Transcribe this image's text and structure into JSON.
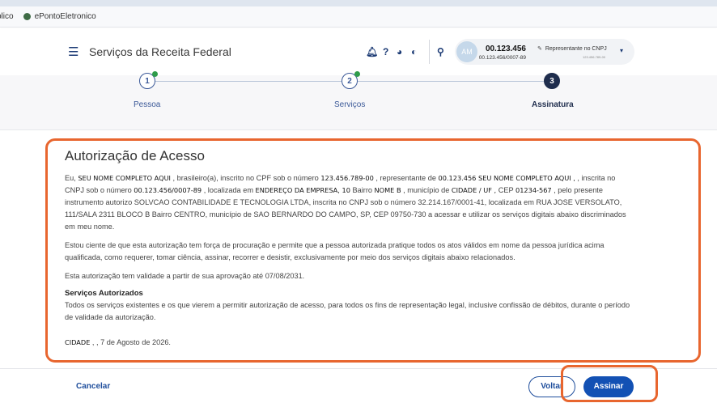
{
  "browser": {
    "bookmarks": [
      {
        "label": "blico"
      },
      {
        "label": "ePontoEletronico"
      }
    ]
  },
  "header": {
    "title": "Serviços da Receita Federal",
    "icons": [
      "bell-icon",
      "help-icon",
      "contrast-icon",
      "theme-icon",
      "search-icon"
    ],
    "user": {
      "avatar_initials": "AM",
      "cnpj": "00.123.456",
      "cnpj_full": "00.123.456/0007-89",
      "role": "Representante no CNPJ",
      "role_sub": "123.456.789-00"
    }
  },
  "stepper": {
    "steps": [
      {
        "number": "1",
        "label": "Pessoa",
        "done": true
      },
      {
        "number": "2",
        "label": "Serviços",
        "done": true
      },
      {
        "number": "3",
        "label": "Assinatura",
        "active": true
      }
    ]
  },
  "authorization": {
    "title": "Autorização de Acesso",
    "p1": {
      "t1": "Eu, ",
      "name": "SEU NOME COMPLETO AQUI",
      "t2": "     , brasileiro(a), inscrito no CPF sob o número ",
      "cpf": "123.456.789-00",
      "t3": " , representante de ",
      "cnpj": "00.123.456",
      "company": " SEU NOME COMPLETO AQUI ,",
      "t4": "         , inscrita no CNPJ sob o número ",
      "cnpj_full": "00.123.456/0007-89",
      "t5": "     , localizada em ",
      "address": "ENDEREÇO DA EMPRESA, 10",
      "t6": " Bairro ",
      "bairro": "NOME B",
      "t7": " , município de ",
      "city": "CIDADE / UF ,",
      "t8": " CEP ",
      "cep": "01234-567",
      "t9": " , pelo presente instrumento autorizo SOLVCAO CONTABILIDADE E TECNOLOGIA LTDA, inscrita no CNPJ sob o número 32.214.167/0001-41, localizada em RUA JOSE VERSOLATO, 111/SALA 2311 BLOCO B Bairro CENTRO, município de SAO BERNARDO DO CAMPO, SP, CEP 09750-730 a acessar e utilizar os serviços digitais abaixo discriminados em meu nome."
    },
    "p2": "Estou ciente de que esta autorização tem força de procuração e permite que a pessoa autorizada pratique todos os atos válidos em nome da pessoa jurídica acima qualificada, como requerer, tomar ciência, assinar, recorrer e desistir, exclusivamente por meio dos serviços digitais abaixo relacionados.",
    "p3": "Esta autorização tem validade a partir de sua aprovação até 07/08/2031.",
    "services_heading": "Serviços Autorizados",
    "p4": "Todos os serviços existentes e os que vierem a permitir autorização de acesso, para todos os fins de representação legal, inclusive confissão de débitos, durante o período de validade da autorização.",
    "date_city": "CIDADE",
    "date_text": " ,  , 7 de Agosto de 2026."
  },
  "footer": {
    "cancel": "Cancelar",
    "back": "Voltar",
    "sign": "Assinar"
  },
  "colors": {
    "primary": "#1351b4",
    "highlight": "#e8662f",
    "step_done": "#2e9c4a"
  }
}
